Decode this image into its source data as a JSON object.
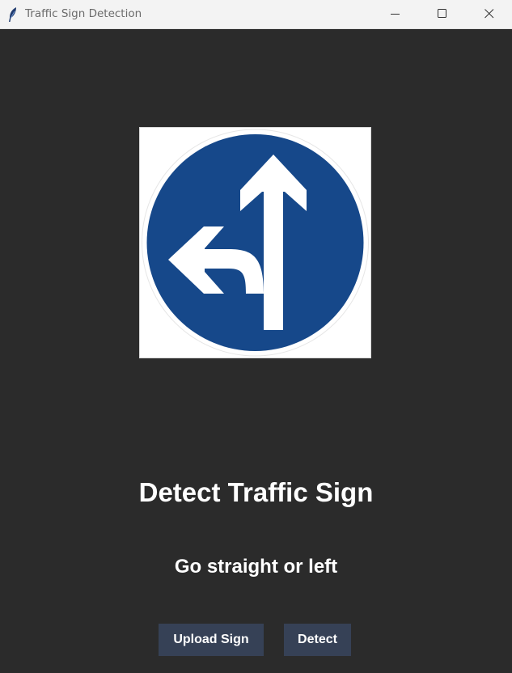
{
  "window": {
    "title": "Traffic Sign Detection",
    "icon": "feather-icon"
  },
  "controls": {
    "minimize_icon": "minimize-icon",
    "maximize_icon": "maximize-icon",
    "close_icon": "close-icon"
  },
  "image": {
    "description_icon": "go-straight-or-left-sign",
    "colors": {
      "sign_blue": "#16488a",
      "arrow_white": "#ffffff"
    }
  },
  "heading": "Detect Traffic Sign",
  "result": "Go straight or left",
  "buttons": {
    "upload_label": "Upload Sign",
    "detect_label": "Detect"
  },
  "colors": {
    "background": "#2b2b2b",
    "button": "#364156",
    "text": "#ffffff"
  }
}
